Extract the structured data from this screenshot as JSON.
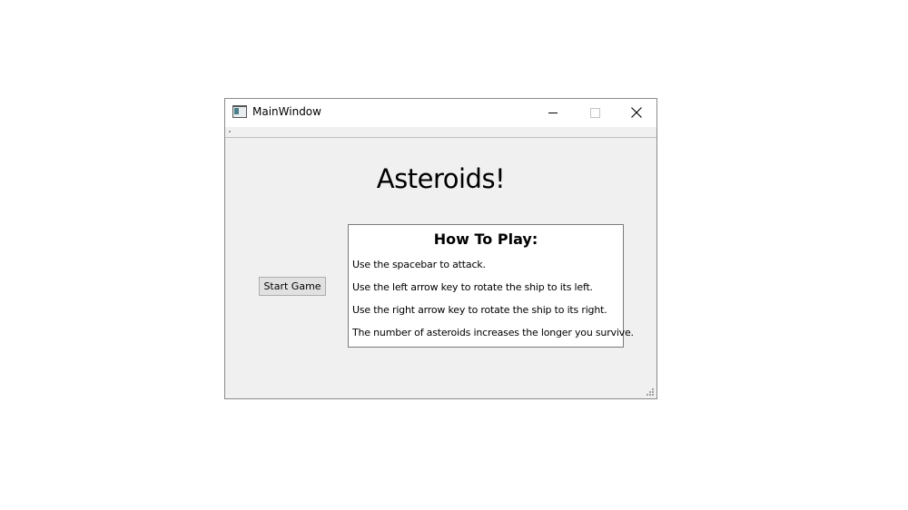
{
  "window": {
    "title": "MainWindow"
  },
  "main": {
    "heading": "Asteroids!",
    "start_button_label": "Start Game",
    "instructions": {
      "title": "How To Play:",
      "lines": [
        "Use the spacebar to attack.",
        "Use the left arrow key to rotate the ship to its left.",
        "Use the right arrow key to rotate the ship to its right.",
        "The number of asteroids increases the longer you survive."
      ]
    }
  },
  "icons": {
    "app": "app-window-icon",
    "minimize": "minimize-icon",
    "maximize": "maximize-icon",
    "close": "close-icon",
    "resize": "resize-grip-icon"
  }
}
